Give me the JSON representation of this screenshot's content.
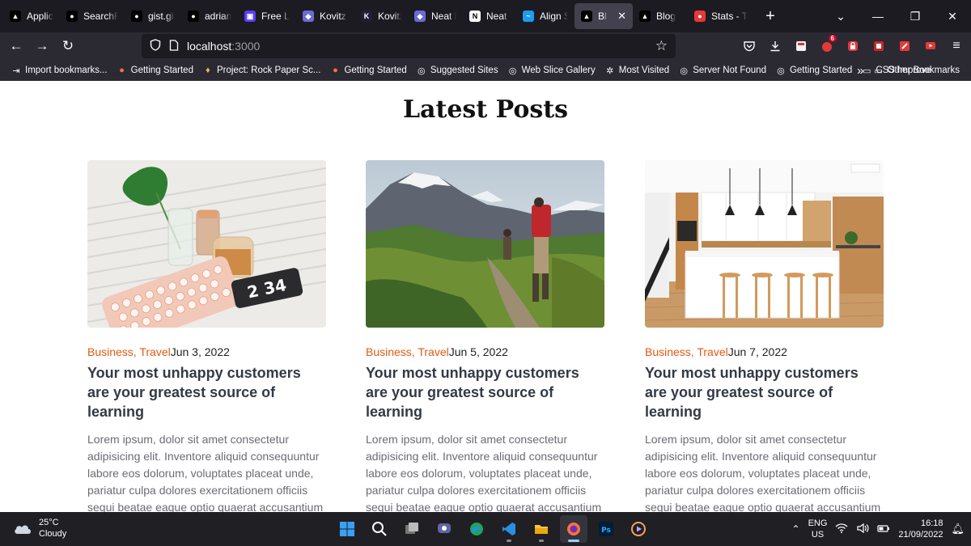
{
  "browser": {
    "tabs": [
      {
        "title": "Applicat",
        "favicon": "vercel-icon",
        "color": "#000000"
      },
      {
        "title": "SearchFi",
        "favicon": "github-icon",
        "color": "#000000"
      },
      {
        "title": "gist.gith",
        "favicon": "github-icon",
        "color": "#000000"
      },
      {
        "title": "adrianha",
        "favicon": "github-icon",
        "color": "#000000"
      },
      {
        "title": "Free Log",
        "favicon": "logo-icon",
        "color": "#5b3df5"
      },
      {
        "title": "Kovitz la",
        "favicon": "kovitz-icon",
        "color": "#6b6bd6"
      },
      {
        "title": "Kovitz –",
        "favicon": "kovitz-k-icon",
        "color": "#1f1f3a"
      },
      {
        "title": "Neat lan",
        "favicon": "neat-icon",
        "color": "#6b6bd6"
      },
      {
        "title": "Neat | Bu",
        "favicon": "notion-icon",
        "color": "#ffffff"
      },
      {
        "title": "Align Se",
        "favicon": "align-icon",
        "color": "#1d9bf0"
      },
      {
        "title": "Blog",
        "favicon": "vercel-icon",
        "color": "#000000",
        "active": true
      },
      {
        "title": "Blog",
        "favicon": "vercel-icon",
        "color": "#000000"
      },
      {
        "title": "Stats - To",
        "favicon": "tomato-icon",
        "color": "#e5383b"
      }
    ],
    "close_label": "✕",
    "new_tab_label": "+",
    "url_host": "localhost",
    "url_port": ":3000",
    "extension_badge": "6",
    "bookmarks": [
      {
        "label": "Import bookmarks...",
        "icon": "import-icon"
      },
      {
        "label": "Getting Started",
        "icon": "firefox-icon"
      },
      {
        "label": "Project: Rock Paper Sc...",
        "icon": "project-icon"
      },
      {
        "label": "Getting Started",
        "icon": "firefox-icon"
      },
      {
        "label": "Suggested Sites",
        "icon": "globe-icon"
      },
      {
        "label": "Web Slice Gallery",
        "icon": "globe-icon"
      },
      {
        "label": "Most Visited",
        "icon": "gear-icon"
      },
      {
        "label": "Server Not Found",
        "icon": "globe-icon"
      },
      {
        "label": "Getting Started",
        "icon": "globe-icon"
      },
      {
        "label": "CSS Improve",
        "icon": "folder-icon"
      }
    ],
    "other_bookmarks": "Other Bookmarks",
    "overflow_label": "»"
  },
  "page": {
    "title": "Latest Posts",
    "posts": [
      {
        "categories": "Business, Travel",
        "date": "Jun 3, 2022",
        "title": "Your most unhappy customers are your greatest source of learning",
        "excerpt": "Lorem ipsum, dolor sit amet consectetur adipisicing elit. Inventore aliquid consequuntur labore eos dolorum, voluptates placeat unde, pariatur culpa dolores exercitationem officiis sequi beatae eaque optio quaerat accusantium debitis neque?",
        "image": "desk-keyboard-photo",
        "clock_text": "2 34"
      },
      {
        "categories": "Business, Travel",
        "date": "Jun 5, 2022",
        "title": "Your most unhappy customers are your greatest source of learning",
        "excerpt": "Lorem ipsum, dolor sit amet consectetur adipisicing elit. Inventore aliquid consequuntur labore eos dolorum, voluptates placeat unde, pariatur culpa dolores exercitationem officiis sequi beatae eaque optio quaerat accusantium debitis neque?",
        "image": "mountain-hikers-photo"
      },
      {
        "categories": "Business, Travel",
        "date": "Jun 7, 2022",
        "title": "Your most unhappy customers are your greatest source of learning",
        "excerpt": "Lorem ipsum, dolor sit amet consectetur adipisicing elit. Inventore aliquid consequuntur labore eos dolorum, voluptates placeat unde, pariatur culpa dolores exercitationem officiis sequi beatae eaque optio quaerat accusantium debitis neque?",
        "image": "kitchen-interior-photo"
      }
    ]
  },
  "taskbar": {
    "weather_temp": "25°C",
    "weather_desc": "Cloudy",
    "apps": [
      "windows-start-icon",
      "search-icon",
      "task-view-icon",
      "chat-icon",
      "edge-icon",
      "vscode-icon",
      "file-explorer-icon",
      "firefox-icon",
      "photoshop-icon",
      "media-player-icon"
    ],
    "lang_line1": "ENG",
    "lang_line2": "US",
    "time": "16:18",
    "date": "21/09/2022"
  },
  "colors": {
    "accent_category": "#e05a13",
    "chrome_dark": "#1c1b22",
    "toolbar": "#2b2a33"
  }
}
